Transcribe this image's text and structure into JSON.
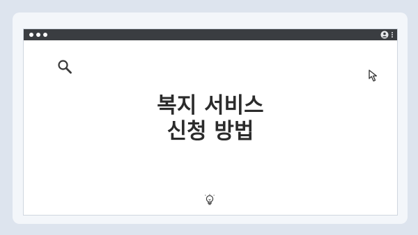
{
  "window": {
    "title_lines": [
      "복지 서비스",
      "신청 방법"
    ]
  },
  "icons": {
    "search": "search-icon",
    "cursor": "cursor-icon",
    "bulb": "lightbulb-icon",
    "user": "user-icon",
    "menu": "more-vert-icon"
  },
  "colors": {
    "background": "#dde4ee",
    "card": "#f3f6fa",
    "titlebar": "#3a3d41",
    "text": "#2b2b2b"
  }
}
